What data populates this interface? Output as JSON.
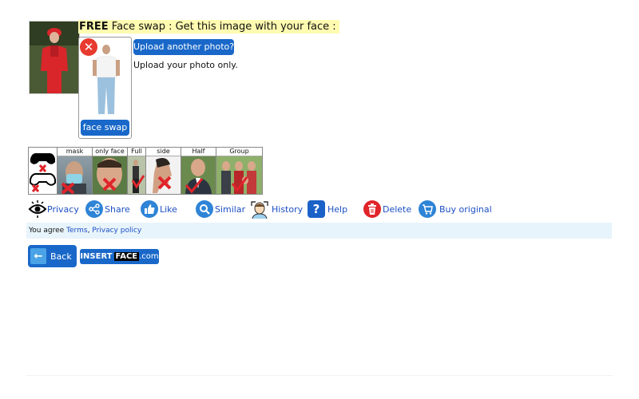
{
  "header": {
    "free": "FREE",
    "title": " Face swap : Get this image with your face :"
  },
  "upload": {
    "another_label": "Upload another photo?",
    "note": "Upload your photo only.",
    "faceswap_label": "face swap",
    "delete_glyph": "✕"
  },
  "guide": {
    "labels": [
      "",
      "mask",
      "only face",
      "Full",
      "side",
      "Half",
      "Group"
    ]
  },
  "toolbar": {
    "privacy": "Privacy",
    "share": "Share",
    "like": "Like",
    "similar": "Similar",
    "history": "History",
    "help": "Help",
    "help_glyph": "?",
    "delete": "Delete",
    "buy": "Buy original"
  },
  "agree": {
    "prefix": "You agree ",
    "terms": "Terms",
    "sep": ", ",
    "privacy": "Privacy policy"
  },
  "nav": {
    "back": "Back",
    "back_glyph": "←",
    "brand_insert": "INSERT",
    "brand_face": "FACE",
    "brand_com": ".com"
  },
  "colors": {
    "accent": "#1968c9",
    "highlight": "#fffbb0",
    "danger": "#e0242a",
    "agree_bg": "#e8f4fb"
  },
  "icons": [
    "eye-icon",
    "share-icon",
    "thumbs-up-icon",
    "search-icon",
    "history-face-icon",
    "help-icon",
    "trash-icon",
    "cart-icon",
    "back-arrow-icon",
    "delete-x-icon",
    "check-icon",
    "cross-icon"
  ]
}
